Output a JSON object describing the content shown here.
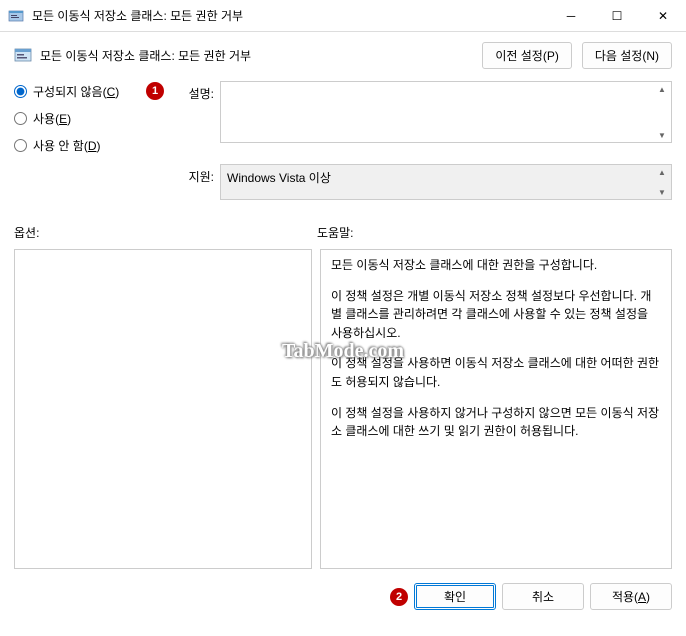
{
  "window": {
    "title": "모든 이동식 저장소 클래스: 모든 권한 거부",
    "minimize": "─",
    "maximize": "☐",
    "close": "✕"
  },
  "header": {
    "title": "모든 이동식 저장소 클래스: 모든 권한 거부",
    "prev_btn": "이전 설정(P)",
    "next_btn": "다음 설정(N)"
  },
  "radios": {
    "not_configured": "구성되지 않음(C)",
    "not_configured_prefix": "구성되지 않음(",
    "not_configured_key": "C",
    "not_configured_suffix": ")",
    "enabled_prefix": "사용(",
    "enabled_key": "E",
    "enabled_suffix": ")",
    "disabled_prefix": "사용 안 함(",
    "disabled_key": "D",
    "disabled_suffix": ")"
  },
  "labels": {
    "description": "설명:",
    "support": "지원:",
    "options": "옵션:",
    "help": "도움말:"
  },
  "fields": {
    "description": "",
    "support": "Windows Vista 이상"
  },
  "help": {
    "p1": "모든 이동식 저장소 클래스에 대한 권한을 구성합니다.",
    "p2": "이 정책 설정은 개별 이동식 저장소 정책 설정보다 우선합니다. 개별 클래스를 관리하려면 각 클래스에 사용할 수 있는 정책 설정을 사용하십시오.",
    "p3": "이 정책 설정을 사용하면 이동식 저장소 클래스에 대한 어떠한 권한도 허용되지 않습니다.",
    "p4": "이 정책 설정을 사용하지 않거나 구성하지 않으면 모든 이동식 저장소 클래스에 대한 쓰기 및 읽기 권한이 허용됩니다."
  },
  "footer": {
    "ok": "확인",
    "cancel": "취소",
    "apply_prefix": "적용(",
    "apply_key": "A",
    "apply_suffix": ")"
  },
  "badges": {
    "one": "1",
    "two": "2"
  },
  "watermark": "TabMode.com"
}
